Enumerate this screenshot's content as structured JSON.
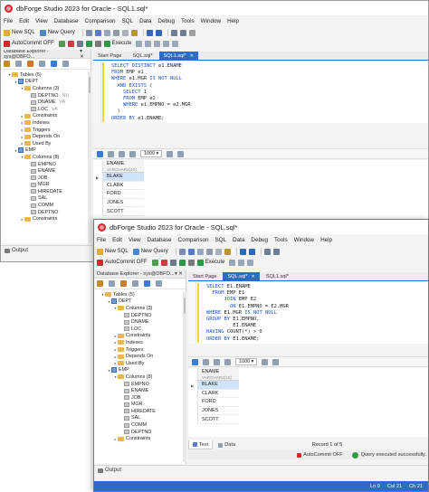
{
  "back": {
    "title": "dbForge Studio 2023 for Oracle - SQL1.sql*",
    "menu": [
      "File",
      "Edit",
      "View",
      "Database",
      "Comparison",
      "SQL",
      "Data",
      "Debug",
      "Tools",
      "Window",
      "Help"
    ],
    "toolbar1": {
      "new_sql": "New SQL",
      "new_query": "New Query"
    },
    "toolbar2": {
      "autocommit": "AutoCommit OFF",
      "execute": "Execute"
    },
    "explorer": {
      "header": "Database Explorer - sys@DBFO...",
      "tree": [
        {
          "label": "Tables (5)",
          "depth": 1,
          "icon": "folder",
          "open": true
        },
        {
          "label": "DEPT",
          "depth": 2,
          "icon": "table",
          "open": true
        },
        {
          "label": "Columns (3)",
          "depth": 3,
          "icon": "folder",
          "open": true
        },
        {
          "label": "DEPTNO",
          "ghost": "NU",
          "depth": 4,
          "icon": "column"
        },
        {
          "label": "DNAME",
          "ghost": "VA",
          "depth": 4,
          "icon": "column"
        },
        {
          "label": "LOC",
          "ghost": "VA",
          "depth": 4,
          "icon": "column"
        },
        {
          "label": "Constraints",
          "depth": 3,
          "icon": "folder"
        },
        {
          "label": "Indexes",
          "depth": 3,
          "icon": "folder"
        },
        {
          "label": "Triggers",
          "depth": 3,
          "icon": "folder"
        },
        {
          "label": "Depends On",
          "depth": 3,
          "icon": "folder"
        },
        {
          "label": "Used By",
          "depth": 3,
          "icon": "folder"
        },
        {
          "label": "EMP",
          "depth": 2,
          "icon": "table",
          "open": true
        },
        {
          "label": "Columns (8)",
          "depth": 3,
          "icon": "folder",
          "open": true
        },
        {
          "label": "EMPNO",
          "depth": 4,
          "icon": "column"
        },
        {
          "label": "ENAME",
          "depth": 4,
          "icon": "column"
        },
        {
          "label": "JOB",
          "depth": 4,
          "icon": "column"
        },
        {
          "label": "MGR",
          "depth": 4,
          "icon": "column"
        },
        {
          "label": "HIREDATE",
          "depth": 4,
          "icon": "column"
        },
        {
          "label": "SAL",
          "depth": 4,
          "icon": "column"
        },
        {
          "label": "COMM",
          "depth": 4,
          "icon": "column"
        },
        {
          "label": "DEPTNO",
          "depth": 4,
          "icon": "column"
        },
        {
          "label": "Constraints",
          "depth": 3,
          "icon": "folder"
        }
      ]
    },
    "tabs": [
      {
        "label": "Start Page",
        "active": false
      },
      {
        "label": "SQL.sql*",
        "active": false
      },
      {
        "label": "SQL1.sql*",
        "active": true
      }
    ],
    "code": [
      "SELECT DISTINCT e1.ENAME",
      "FROM EMP e1",
      "WHERE e1.MGR IS NOT NULL",
      "  AND EXISTS (",
      "    SELECT 1",
      "    FROM EMP e2",
      "    WHERE e1.EMPNO = e2.MGR",
      "  )",
      "ORDER BY e1.ENAME;"
    ],
    "pager_value": "1000",
    "result": {
      "column": "ENAME",
      "type": "VARCHAR2(10)",
      "rows": [
        "BLAKE",
        "CLARK",
        "FORD",
        "JONES",
        "SCOTT"
      ]
    },
    "output_label": "Output"
  },
  "front": {
    "title": "dbForge Studio 2023 for Oracle - SQL.sql*",
    "menu": [
      "File",
      "Edit",
      "View",
      "Database",
      "Comparison",
      "SQL",
      "Data",
      "Debug",
      "Tools",
      "Window",
      "Help"
    ],
    "toolbar1": {
      "new_sql": "New SQL",
      "new_query": "New Query"
    },
    "toolbar2": {
      "autocommit": "AutoCommit OFF",
      "execute": "Execute"
    },
    "explorer": {
      "header": "Database Explorer - sys@DBFO...",
      "tree": [
        {
          "label": "Tables (5)",
          "depth": 1,
          "icon": "folder",
          "open": true
        },
        {
          "label": "DEPT",
          "depth": 2,
          "icon": "table",
          "open": true
        },
        {
          "label": "Columns (3)",
          "depth": 3,
          "icon": "folder",
          "open": true
        },
        {
          "label": "DEPTNO",
          "depth": 4,
          "icon": "column"
        },
        {
          "label": "DNAME",
          "depth": 4,
          "icon": "column"
        },
        {
          "label": "LOC",
          "depth": 4,
          "icon": "column"
        },
        {
          "label": "Constraints",
          "depth": 3,
          "icon": "folder"
        },
        {
          "label": "Indexes",
          "depth": 3,
          "icon": "folder"
        },
        {
          "label": "Triggers",
          "depth": 3,
          "icon": "folder"
        },
        {
          "label": "Depends On",
          "depth": 3,
          "icon": "folder"
        },
        {
          "label": "Used By",
          "depth": 3,
          "icon": "folder"
        },
        {
          "label": "EMP",
          "depth": 2,
          "icon": "table",
          "open": true
        },
        {
          "label": "Columns (8)",
          "depth": 3,
          "icon": "folder",
          "open": true
        },
        {
          "label": "EMPNO",
          "depth": 4,
          "icon": "column"
        },
        {
          "label": "ENAME",
          "depth": 4,
          "icon": "column"
        },
        {
          "label": "JOB",
          "depth": 4,
          "icon": "column"
        },
        {
          "label": "MGR",
          "depth": 4,
          "icon": "column"
        },
        {
          "label": "HIREDATE",
          "depth": 4,
          "icon": "column"
        },
        {
          "label": "SAL",
          "depth": 4,
          "icon": "column"
        },
        {
          "label": "COMM",
          "depth": 4,
          "icon": "column"
        },
        {
          "label": "DEPTNO",
          "depth": 4,
          "icon": "column"
        },
        {
          "label": "Constraints",
          "depth": 3,
          "icon": "folder"
        }
      ]
    },
    "tabs": [
      {
        "label": "Start Page",
        "active": false
      },
      {
        "label": "SQL.sql*",
        "active": true
      },
      {
        "label": "SQL1.sql*",
        "active": false
      }
    ],
    "code": [
      "SELECT E1.ENAME",
      "  FROM EMP E1",
      "      JOIN EMP E2",
      "        ON E1.EMPNO = E2.MGR",
      "WHERE E1.MGR IS NOT NULL",
      "GROUP BY E1.EMPNO,",
      "         E1.ENAME",
      "HAVING COUNT(*) > 0",
      "ORDER BY E1.ENAME;"
    ],
    "pager_value": "1000",
    "result": {
      "column": "ENAME",
      "type": "VARCHAR2(10)",
      "rows": [
        "BLAKE",
        "CLARK",
        "FORD",
        "JONES",
        "SCOTT"
      ]
    },
    "bottom_tabs": {
      "text": "Text",
      "data": "Data"
    },
    "record": "Record 1 of 5",
    "autocommit_status": "AutoCommit OFF",
    "query_status": "Query executed successfully.",
    "status": {
      "ln": "Ln 9",
      "col": "Col 21",
      "ch": "Ch 21"
    },
    "output_label": "Output"
  },
  "colors": {
    "accent": "#2b6cc4",
    "logo": "#d2282e",
    "keyword": "#1a52c6",
    "success": "#2f9a44"
  }
}
